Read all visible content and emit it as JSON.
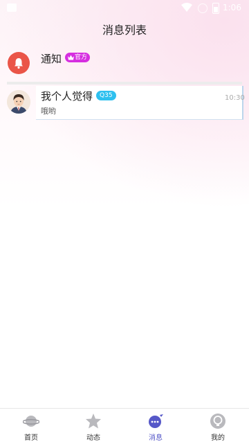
{
  "status_bar": {
    "time": "1:06"
  },
  "header": {
    "title": "消息列表"
  },
  "notice": {
    "label": "通知",
    "badge": "官方"
  },
  "messages": [
    {
      "name": "我个人觉得",
      "level": "35",
      "preview": "哦哟",
      "time": "10:30"
    }
  ],
  "tabbar": {
    "items": [
      {
        "label": "首页",
        "icon": "planet-icon"
      },
      {
        "label": "动态",
        "icon": "star-icon"
      },
      {
        "label": "消息",
        "icon": "chat-bubble-icon"
      },
      {
        "label": "我的",
        "icon": "bulb-icon"
      }
    ],
    "active_index": 2
  },
  "colors": {
    "accent": "#5658c8",
    "notice_red": "#ea5548",
    "official_badge": "#d62ee0",
    "level_badge": "#2ec0ef"
  }
}
